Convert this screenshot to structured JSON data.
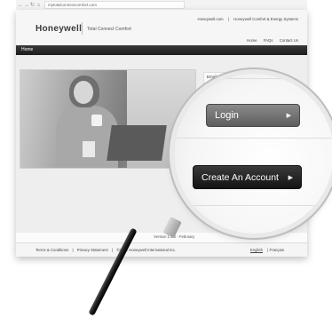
{
  "browser": {
    "address": "mytotalconnectcomfort.com"
  },
  "header": {
    "logo": "Honeywell",
    "product_title": "Total Connect Comfort",
    "top_links": [
      "Honeywell.com",
      "Honeywell Comfort & Energy Systems"
    ],
    "util_links": [
      "Home",
      "FAQs",
      "Contact Us"
    ]
  },
  "nav": {
    "home_label": "Home"
  },
  "login": {
    "email_label": "Email Address"
  },
  "magnifier": {
    "login_label": "Login",
    "create_account_label": "Create An Account",
    "arrow_glyph": "▶"
  },
  "footer": {
    "version_text": "Version 1.2.2 - February",
    "left_links": [
      "Terms & Conditions",
      "|",
      "Privacy Statement",
      "|",
      "©2012 Honeywell International Inc."
    ],
    "lang_selected": "English",
    "lang_other": "Français"
  }
}
